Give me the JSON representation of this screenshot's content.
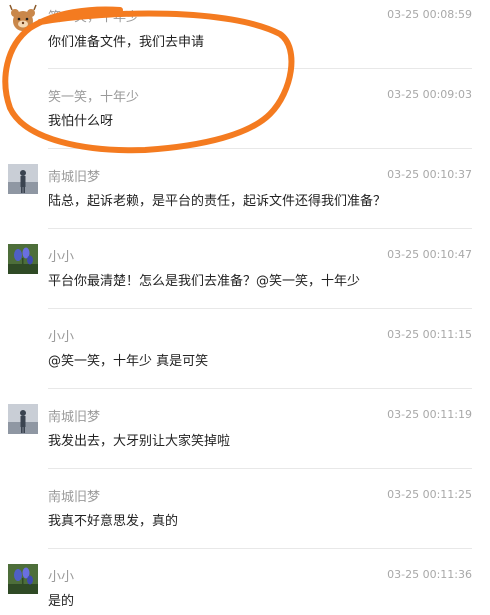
{
  "messages": [
    {
      "name": "笑一笑，十年少",
      "time": "03-25 00:08:59",
      "text": "你们准备文件，我们去申请",
      "avatar": "bear-avatar"
    },
    {
      "name": "笑一笑，十年少",
      "time": "03-25 00:09:03",
      "text": "我怕什么呀",
      "avatar": ""
    },
    {
      "name": "南城旧梦",
      "time": "03-25 00:10:37",
      "text": "陆总，起诉老赖，是平台的责任，起诉文件还得我们准备？",
      "avatar": "person-avatar"
    },
    {
      "name": "小小",
      "time": "03-25 00:10:47",
      "text": "平台你最清楚！怎么是我们去准备？@笑一笑，十年少",
      "avatar": "flower-avatar"
    },
    {
      "name": "小小",
      "time": "03-25 00:11:15",
      "text": "@笑一笑，十年少 真是可笑",
      "avatar": ""
    },
    {
      "name": "南城旧梦",
      "time": "03-25 00:11:19",
      "text": "我发出去，大牙别让大家笑掉啦",
      "avatar": "person-avatar"
    },
    {
      "name": "南城旧梦",
      "time": "03-25 00:11:25",
      "text": "我真不好意思发，真的",
      "avatar": ""
    },
    {
      "name": "小小",
      "time": "03-25 00:11:36",
      "text": "是的",
      "avatar": "flower-avatar"
    }
  ],
  "colors": {
    "annotation": "#F47B20",
    "name_text": "#9a9a9a",
    "body_text": "#222222",
    "divider": "#e8e8e8"
  }
}
